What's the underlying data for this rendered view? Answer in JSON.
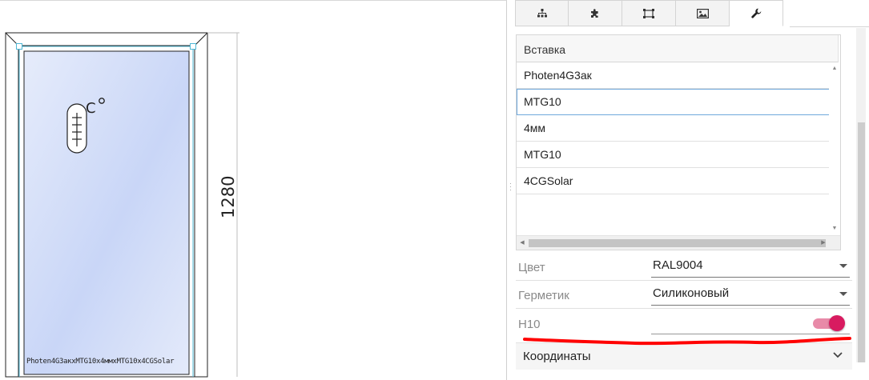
{
  "drawing": {
    "dimension_label": "1280",
    "glass_label": "Photen4G3акхMTG10x4ммхMTG10x4CGSolar"
  },
  "panel": {
    "tabs": [
      {
        "icon": "hierarchy-icon"
      },
      {
        "icon": "puzzle-icon"
      },
      {
        "icon": "dimensions-icon"
      },
      {
        "icon": "image-icon"
      },
      {
        "icon": "wrench-icon",
        "active": true
      }
    ],
    "grid": {
      "header": "Вставка",
      "rows": [
        "Photen4G3ак",
        "MTG10",
        "4мм",
        "MTG10",
        "4CGSolar"
      ],
      "selected_index": 1
    },
    "properties": [
      {
        "label": "Цвет",
        "value": "RAL9004"
      },
      {
        "label": "Герметик",
        "value": "Силиконовый"
      },
      {
        "label": "H10",
        "toggle": true
      }
    ],
    "accordion_title": "Координаты",
    "colors": {
      "accent": "#d81b60",
      "underline": "#ff0000",
      "selection": "#6fa8dc"
    }
  }
}
